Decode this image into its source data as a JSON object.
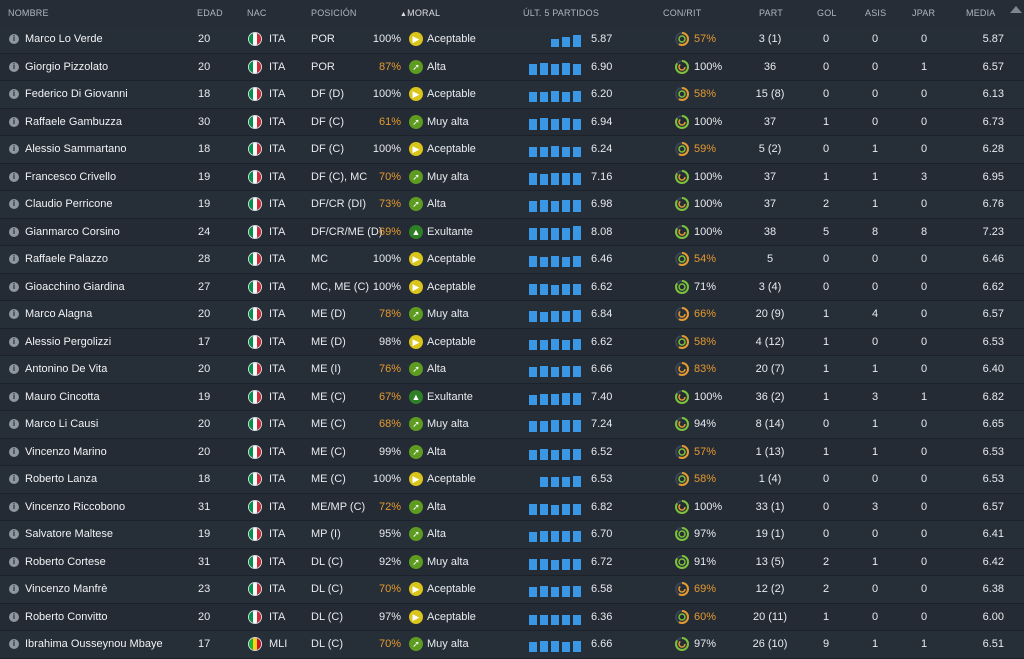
{
  "header": {
    "nombre": "NOMBRE",
    "edad": "EDAD",
    "nac": "NAC",
    "posicion": "POSICIÓN",
    "moral": "MORAL",
    "ult5": "ÚLT. 5 PARTIDOS",
    "conrit": "CON/RIT",
    "part": "PART",
    "gol": "GOL",
    "asis": "ASIS",
    "jpar": "JPAR",
    "media": "MEDIA"
  },
  "colors": {
    "accent_bar": "#3a97e6",
    "good": "#5d9b21",
    "orange": "#e59a2f",
    "moral_yellow": "#d9c51b"
  },
  "players": [
    {
      "name": "Marco Lo Verde",
      "edad": "20",
      "nac": "ITA",
      "flag": "italy",
      "pos": "POR",
      "moral": "Aceptable",
      "moral_icon": "yellow",
      "form": [
        0,
        0,
        0.52,
        0.62,
        0.78
      ],
      "form_val": "5.87",
      "con": "100%",
      "rit": "57%",
      "con_o": false,
      "rit_o": true,
      "part": "3 (1)",
      "gol": "0",
      "asis": "0",
      "jpar": "0",
      "media": "5.87"
    },
    {
      "name": "Giorgio Pizzolato",
      "edad": "20",
      "nac": "ITA",
      "flag": "italy",
      "pos": "POR",
      "moral": "Alta",
      "moral_icon": "green",
      "form": [
        0.68,
        0.72,
        0.68,
        0.74,
        0.7
      ],
      "form_val": "6.90",
      "con": "87%",
      "rit": "100%",
      "con_o": true,
      "rit_o": false,
      "part": "36",
      "gol": "0",
      "asis": "0",
      "jpar": "1",
      "media": "6.57"
    },
    {
      "name": "Federico Di Giovanni",
      "edad": "18",
      "nac": "ITA",
      "flag": "italy",
      "pos": "DF (D)",
      "moral": "Aceptable",
      "moral_icon": "yellow",
      "form": [
        0.64,
        0.62,
        0.66,
        0.62,
        0.68
      ],
      "form_val": "6.20",
      "con": "100%",
      "rit": "58%",
      "con_o": false,
      "rit_o": true,
      "part": "15 (8)",
      "gol": "0",
      "asis": "0",
      "jpar": "0",
      "media": "6.13"
    },
    {
      "name": "Raffaele Gambuzza",
      "edad": "30",
      "nac": "ITA",
      "flag": "italy",
      "pos": "DF (C)",
      "moral": "Muy alta",
      "moral_icon": "green",
      "form": [
        0.7,
        0.74,
        0.7,
        0.72,
        0.7
      ],
      "form_val": "6.94",
      "con": "61%",
      "rit": "100%",
      "con_o": true,
      "rit_o": false,
      "part": "37",
      "gol": "1",
      "asis": "0",
      "jpar": "0",
      "media": "6.73"
    },
    {
      "name": "Alessio Sammartano",
      "edad": "18",
      "nac": "ITA",
      "flag": "italy",
      "pos": "DF (C)",
      "moral": "Aceptable",
      "moral_icon": "yellow",
      "form": [
        0.64,
        0.62,
        0.66,
        0.62,
        0.64
      ],
      "form_val": "6.24",
      "con": "100%",
      "rit": "59%",
      "con_o": false,
      "rit_o": true,
      "part": "5 (2)",
      "gol": "0",
      "asis": "1",
      "jpar": "0",
      "media": "6.28"
    },
    {
      "name": "Francesco Crivello",
      "edad": "19",
      "nac": "ITA",
      "flag": "italy",
      "pos": "DF (C), MC",
      "moral": "Muy alta",
      "moral_icon": "green",
      "form": [
        0.72,
        0.7,
        0.74,
        0.72,
        0.78
      ],
      "form_val": "7.16",
      "con": "70%",
      "rit": "100%",
      "con_o": true,
      "rit_o": false,
      "part": "37",
      "gol": "1",
      "asis": "1",
      "jpar": "3",
      "media": "6.95"
    },
    {
      "name": "Claudio Perricone",
      "edad": "19",
      "nac": "ITA",
      "flag": "italy",
      "pos": "DF/CR (DI)",
      "moral": "Alta",
      "moral_icon": "green",
      "form": [
        0.7,
        0.72,
        0.7,
        0.72,
        0.74
      ],
      "form_val": "6.98",
      "con": "73%",
      "rit": "100%",
      "con_o": true,
      "rit_o": false,
      "part": "37",
      "gol": "2",
      "asis": "1",
      "jpar": "0",
      "media": "6.76"
    },
    {
      "name": "Gianmarco Corsino",
      "edad": "24",
      "nac": "ITA",
      "flag": "italy",
      "pos": "DF/CR/ME (D)",
      "moral": "Exultante",
      "moral_icon": "dgreen",
      "form": [
        0.74,
        0.76,
        0.72,
        0.78,
        0.86
      ],
      "form_val": "8.08",
      "con": "69%",
      "rit": "100%",
      "con_o": true,
      "rit_o": false,
      "part": "38",
      "gol": "5",
      "asis": "8",
      "jpar": "8",
      "media": "7.23"
    },
    {
      "name": "Raffaele Palazzo",
      "edad": "28",
      "nac": "ITA",
      "flag": "italy",
      "pos": "MC",
      "moral": "Aceptable",
      "moral_icon": "yellow",
      "form": [
        0.66,
        0.64,
        0.66,
        0.64,
        0.66
      ],
      "form_val": "6.46",
      "con": "100%",
      "rit": "54%",
      "con_o": false,
      "rit_o": true,
      "part": "5",
      "gol": "0",
      "asis": "0",
      "jpar": "0",
      "media": "6.46"
    },
    {
      "name": "Gioacchino Giardina",
      "edad": "27",
      "nac": "ITA",
      "flag": "italy",
      "pos": "MC, ME (C)",
      "moral": "Aceptable",
      "moral_icon": "yellow",
      "form": [
        0.66,
        0.68,
        0.64,
        0.66,
        0.68
      ],
      "form_val": "6.62",
      "con": "100%",
      "rit": "71%",
      "con_o": false,
      "rit_o": false,
      "part": "3 (4)",
      "gol": "0",
      "asis": "0",
      "jpar": "0",
      "media": "6.62"
    },
    {
      "name": "Marco Alagna",
      "edad": "20",
      "nac": "ITA",
      "flag": "italy",
      "pos": "ME (D)",
      "moral": "Muy alta",
      "moral_icon": "green",
      "form": [
        0.66,
        0.64,
        0.7,
        0.68,
        0.74
      ],
      "form_val": "6.84",
      "con": "78%",
      "rit": "66%",
      "con_o": true,
      "rit_o": true,
      "part": "20 (9)",
      "gol": "1",
      "asis": "4",
      "jpar": "0",
      "media": "6.57"
    },
    {
      "name": "Alessio Pergolizzi",
      "edad": "17",
      "nac": "ITA",
      "flag": "italy",
      "pos": "ME (D)",
      "moral": "Aceptable",
      "moral_icon": "yellow",
      "form": [
        0.62,
        0.64,
        0.66,
        0.64,
        0.68
      ],
      "form_val": "6.62",
      "con": "98%",
      "rit": "58%",
      "con_o": false,
      "rit_o": true,
      "part": "4 (12)",
      "gol": "1",
      "asis": "0",
      "jpar": "0",
      "media": "6.53"
    },
    {
      "name": "Antonino De Vita",
      "edad": "20",
      "nac": "ITA",
      "flag": "italy",
      "pos": "ME (I)",
      "moral": "Alta",
      "moral_icon": "green",
      "form": [
        0.62,
        0.68,
        0.64,
        0.7,
        0.66
      ],
      "form_val": "6.66",
      "con": "76%",
      "rit": "83%",
      "con_o": true,
      "rit_o": true,
      "part": "20 (7)",
      "gol": "1",
      "asis": "1",
      "jpar": "0",
      "media": "6.40"
    },
    {
      "name": "Mauro Cincotta",
      "edad": "19",
      "nac": "ITA",
      "flag": "italy",
      "pos": "ME (C)",
      "moral": "Exultante",
      "moral_icon": "dgreen",
      "form": [
        0.64,
        0.7,
        0.66,
        0.72,
        0.78
      ],
      "form_val": "7.40",
      "con": "67%",
      "rit": "100%",
      "con_o": true,
      "rit_o": false,
      "part": "36 (2)",
      "gol": "1",
      "asis": "3",
      "jpar": "1",
      "media": "6.82"
    },
    {
      "name": "Marco Li Causi",
      "edad": "20",
      "nac": "ITA",
      "flag": "italy",
      "pos": "ME (C)",
      "moral": "Muy alta",
      "moral_icon": "green",
      "form": [
        0.66,
        0.7,
        0.74,
        0.72,
        0.76
      ],
      "form_val": "7.24",
      "con": "68%",
      "rit": "94%",
      "con_o": true,
      "rit_o": false,
      "part": "8 (14)",
      "gol": "0",
      "asis": "1",
      "jpar": "0",
      "media": "6.65"
    },
    {
      "name": "Vincenzo Marino",
      "edad": "20",
      "nac": "ITA",
      "flag": "italy",
      "pos": "ME (C)",
      "moral": "Alta",
      "moral_icon": "green",
      "form": [
        0.62,
        0.66,
        0.64,
        0.68,
        0.66
      ],
      "form_val": "6.52",
      "con": "99%",
      "rit": "57%",
      "con_o": false,
      "rit_o": true,
      "part": "1 (13)",
      "gol": "1",
      "asis": "1",
      "jpar": "0",
      "media": "6.53"
    },
    {
      "name": "Roberto Lanza",
      "edad": "18",
      "nac": "ITA",
      "flag": "italy",
      "pos": "ME (C)",
      "moral": "Aceptable",
      "moral_icon": "yellow",
      "form": [
        0,
        0.62,
        0.64,
        0.62,
        0.66
      ],
      "form_val": "6.53",
      "con": "100%",
      "rit": "58%",
      "con_o": false,
      "rit_o": true,
      "part": "1 (4)",
      "gol": "0",
      "asis": "0",
      "jpar": "0",
      "media": "6.53"
    },
    {
      "name": "Vincenzo Riccobono",
      "edad": "31",
      "nac": "ITA",
      "flag": "italy",
      "pos": "ME/MP (C)",
      "moral": "Alta",
      "moral_icon": "green",
      "form": [
        0.66,
        0.68,
        0.64,
        0.7,
        0.68
      ],
      "form_val": "6.82",
      "con": "72%",
      "rit": "100%",
      "con_o": true,
      "rit_o": false,
      "part": "33 (1)",
      "gol": "0",
      "asis": "3",
      "jpar": "0",
      "media": "6.57"
    },
    {
      "name": "Salvatore Maltese",
      "edad": "19",
      "nac": "ITA",
      "flag": "italy",
      "pos": "MP (I)",
      "moral": "Alta",
      "moral_icon": "green",
      "form": [
        0.64,
        0.66,
        0.68,
        0.66,
        0.7
      ],
      "form_val": "6.70",
      "con": "95%",
      "rit": "97%",
      "con_o": false,
      "rit_o": false,
      "part": "19 (1)",
      "gol": "0",
      "asis": "0",
      "jpar": "0",
      "media": "6.41"
    },
    {
      "name": "Roberto Cortese",
      "edad": "31",
      "nac": "ITA",
      "flag": "italy",
      "pos": "DL (C)",
      "moral": "Muy alta",
      "moral_icon": "green",
      "form": [
        0.66,
        0.68,
        0.64,
        0.7,
        0.68
      ],
      "form_val": "6.72",
      "con": "92%",
      "rit": "91%",
      "con_o": false,
      "rit_o": false,
      "part": "13 (5)",
      "gol": "2",
      "asis": "1",
      "jpar": "0",
      "media": "6.42"
    },
    {
      "name": "Vincenzo Manfrè",
      "edad": "23",
      "nac": "ITA",
      "flag": "italy",
      "pos": "DL (C)",
      "moral": "Aceptable",
      "moral_icon": "yellow",
      "form": [
        0.64,
        0.66,
        0.62,
        0.66,
        0.68
      ],
      "form_val": "6.58",
      "con": "70%",
      "rit": "69%",
      "con_o": true,
      "rit_o": true,
      "part": "12 (2)",
      "gol": "2",
      "asis": "0",
      "jpar": "0",
      "media": "6.38"
    },
    {
      "name": "Roberto Convitto",
      "edad": "20",
      "nac": "ITA",
      "flag": "italy",
      "pos": "DL (C)",
      "moral": "Aceptable",
      "moral_icon": "yellow",
      "form": [
        0.62,
        0.6,
        0.64,
        0.62,
        0.64
      ],
      "form_val": "6.36",
      "con": "97%",
      "rit": "60%",
      "con_o": false,
      "rit_o": true,
      "part": "20 (11)",
      "gol": "1",
      "asis": "0",
      "jpar": "0",
      "media": "6.00"
    },
    {
      "name": "Ibrahima Ousseynou Mbaye",
      "edad": "17",
      "nac": "MLI",
      "flag": "mali",
      "pos": "DL (C)",
      "moral": "Muy alta",
      "moral_icon": "green",
      "form": [
        0.64,
        0.66,
        0.68,
        0.64,
        0.7
      ],
      "form_val": "6.66",
      "con": "70%",
      "rit": "97%",
      "con_o": true,
      "rit_o": false,
      "part": "26 (10)",
      "gol": "9",
      "asis": "1",
      "jpar": "1",
      "media": "6.51"
    }
  ]
}
